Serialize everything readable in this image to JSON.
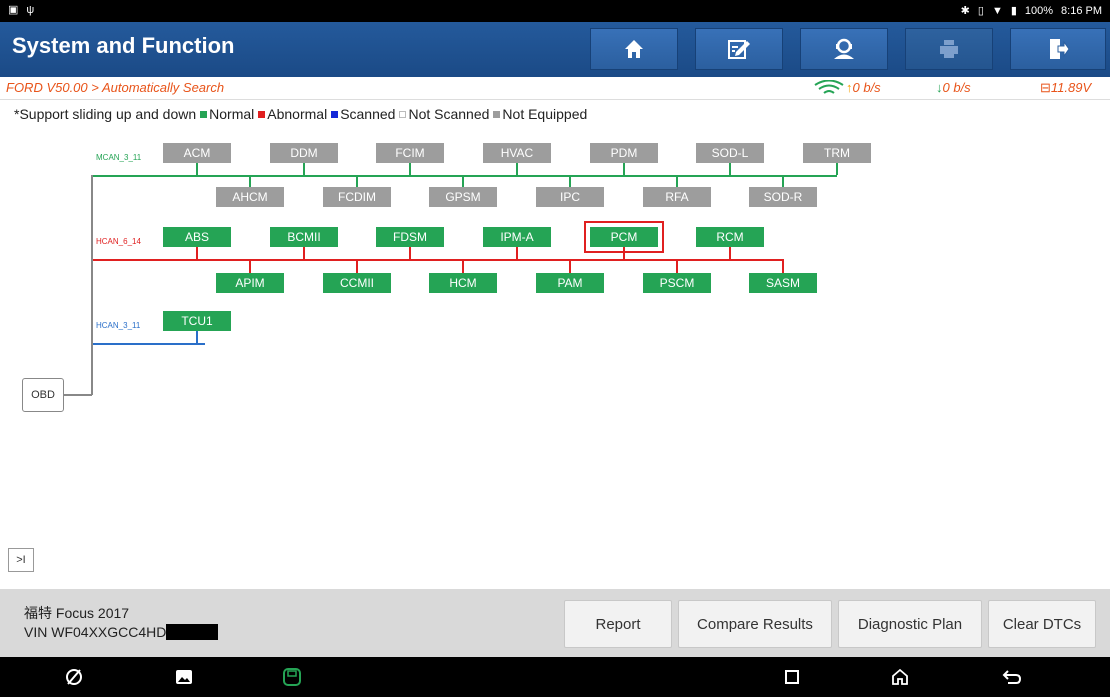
{
  "status_bar": {
    "time": "8:16 PM",
    "battery": "100%",
    "left_icons": [
      "gallery-icon",
      "usb-icon"
    ],
    "right_icons": [
      "bluetooth-icon",
      "vibrate-icon",
      "wifi-icon",
      "battery-icon"
    ]
  },
  "header": {
    "title": "System and Function",
    "buttons": [
      {
        "name": "home",
        "icon": "home-icon"
      },
      {
        "name": "edit",
        "icon": "edit-icon"
      },
      {
        "name": "remote",
        "icon": "support-icon"
      },
      {
        "name": "print",
        "icon": "print-icon"
      },
      {
        "name": "exit",
        "icon": "exit-icon"
      }
    ]
  },
  "pathbar": {
    "path": "FORD V50.00 > Automatically Search",
    "upload": "0 b/s",
    "download": "0 b/s",
    "voltage": "11.89V"
  },
  "legend": {
    "note": "*Support sliding up and down",
    "items": [
      {
        "label": "Normal",
        "color": "#25a455"
      },
      {
        "label": "Abnormal",
        "color": "#e02020"
      },
      {
        "label": "Scanned",
        "color": "#1428d8"
      },
      {
        "label": "Not Scanned",
        "color": "#ffffff"
      },
      {
        "label": "Not Equipped",
        "color": "#9d9d9d"
      }
    ]
  },
  "network": {
    "buses": [
      {
        "name": "MCAN_3_11",
        "color": "#25a455",
        "top": [
          "ACM",
          "DDM",
          "FCIM",
          "HVAC",
          "PDM",
          "SOD-L",
          "TRM"
        ],
        "bottom": [
          "AHCM",
          "FCDIM",
          "GPSM",
          "IPC",
          "RFA",
          "SOD-R"
        ],
        "status": "Not Equipped"
      },
      {
        "name": "HCAN_6_14",
        "color": "#e02020",
        "top": [
          "ABS",
          "BCMII",
          "FDSM",
          "IPM-A",
          "PCM",
          "RCM"
        ],
        "bottom": [
          "APIM",
          "CCMII",
          "HCM",
          "PAM",
          "PSCM",
          "SASM"
        ],
        "status": "Normal",
        "highlighted": "PCM"
      },
      {
        "name": "HCAN_3_11",
        "color": "#2a6fc9",
        "top": [
          "TCU1"
        ],
        "bottom": [],
        "status": "Normal"
      }
    ],
    "obd_label": "OBD",
    "expand_label": ">I"
  },
  "footer": {
    "vehicle_name": "福特 Focus 2017",
    "vin_prefix": "VIN WF04XXGCC4HD",
    "buttons": [
      "Report",
      "Compare Results",
      "Diagnostic Plan",
      "Clear DTCs"
    ]
  },
  "nav_bar": {
    "icons": [
      "browser-icon",
      "gallery-icon",
      "vci-icon",
      "recents-icon",
      "home-icon",
      "back-icon"
    ]
  }
}
